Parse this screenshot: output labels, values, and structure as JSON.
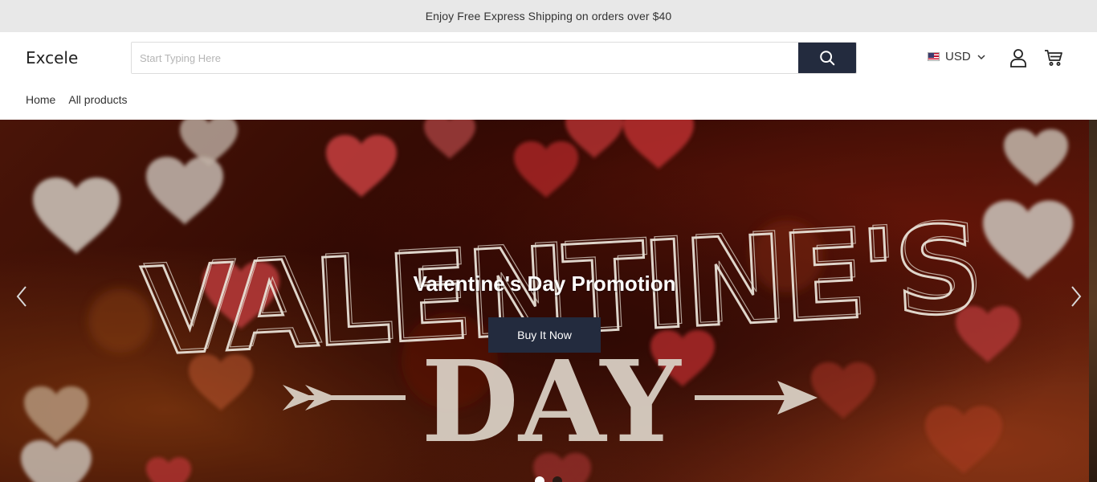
{
  "announcement": {
    "text": "Enjoy Free Express Shipping on orders over $40"
  },
  "header": {
    "logo": "Excele",
    "search": {
      "placeholder": "Start Typing Here",
      "value": "",
      "button_icon": "search-icon"
    },
    "currency": {
      "label": "USD",
      "flag": "us-flag-icon",
      "dropdown_icon": "chevron-down-icon"
    },
    "account_icon": "user-icon",
    "cart_icon": "cart-icon"
  },
  "nav": {
    "items": [
      {
        "label": "Home"
      },
      {
        "label": "All products"
      }
    ]
  },
  "hero": {
    "title": "Valentine's Day Promotion",
    "button_label": "Buy It Now",
    "image_text_top": "VALENTINE'S",
    "image_text_bottom": "DAY",
    "prev_icon": "chevron-left-icon",
    "next_icon": "chevron-right-icon",
    "slides_count": 2,
    "active_slide": 1
  },
  "colors": {
    "announcement_bg": "#e8e8e8",
    "primary_dark": "#232b3e",
    "text": "#333333"
  }
}
